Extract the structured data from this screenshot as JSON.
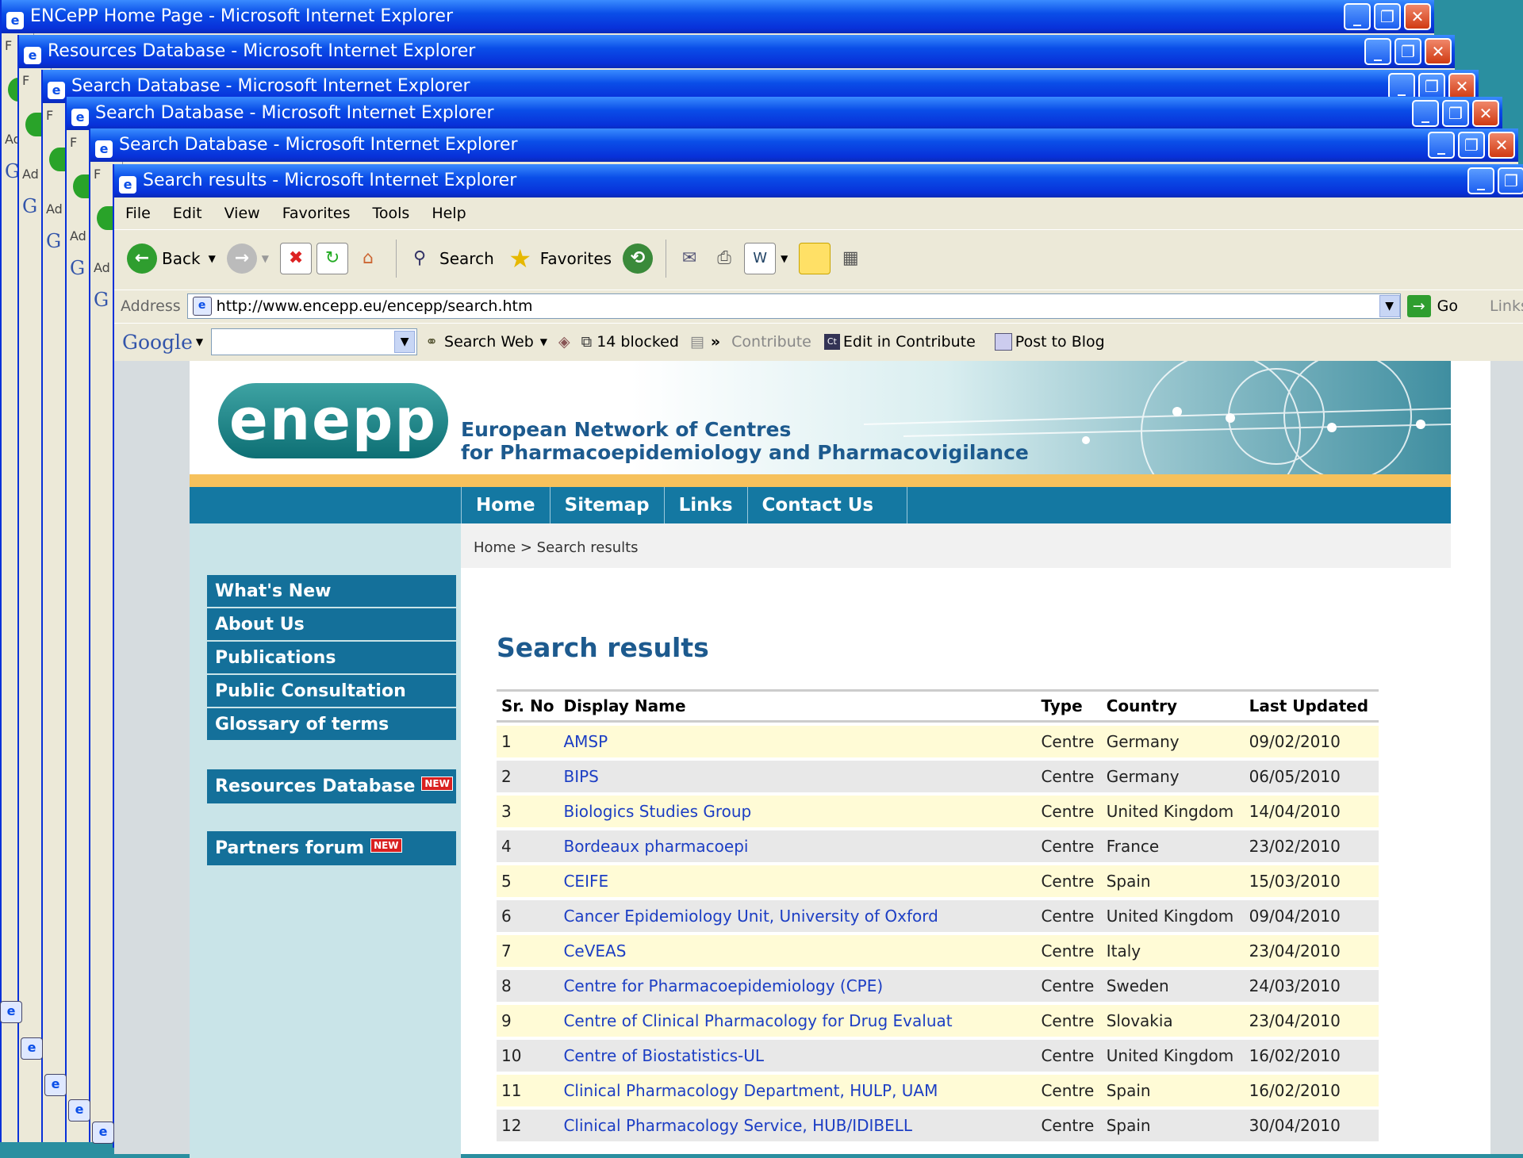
{
  "windows": [
    {
      "title": "ENCePP Home Page - Microsoft Internet Explorer"
    },
    {
      "title": "Resources Database - Microsoft Internet Explorer"
    },
    {
      "title": "Search Database - Microsoft Internet Explorer"
    },
    {
      "title": "Search Database - Microsoft Internet Explorer"
    },
    {
      "title": "Search Database - Microsoft Internet Explorer"
    },
    {
      "title": "Search results - Microsoft Internet Explorer"
    }
  ],
  "strip": {
    "f": "F",
    "ad": "Ad",
    "g": "G"
  },
  "menu": {
    "file": "File",
    "edit": "Edit",
    "view": "View",
    "favorites": "Favorites",
    "tools": "Tools",
    "help": "Help"
  },
  "toolbar": {
    "back": "Back",
    "search": "Search",
    "favorites": "Favorites"
  },
  "address": {
    "label": "Address",
    "url": "http://www.encepp.eu/encepp/search.htm",
    "go": "Go",
    "links": "Links"
  },
  "google": {
    "logo": "Google",
    "search_web": "Search Web",
    "blocked": "14 blocked",
    "more": "»",
    "contribute": "Contribute",
    "edit_contribute": "Edit in Contribute",
    "post_blog": "Post to Blog"
  },
  "site": {
    "logo": "enepp",
    "tagline1": "European Network of Centres",
    "tagline2": "for Pharmacoepidemiology and Pharmacovigilance",
    "nav": [
      "Home",
      "Sitemap",
      "Links",
      "Contact Us"
    ],
    "breadcrumb": "Home > Search results",
    "sidebar": [
      "What's New",
      "About Us",
      "Publications",
      "Public Consultation",
      "Glossary of terms"
    ],
    "resources_db": "Resources Database",
    "partners_forum": "Partners forum",
    "new_badge": "NEW",
    "heading": "Search results"
  },
  "table": {
    "headers": [
      "Sr. No",
      "Display Name",
      "Type",
      "Country",
      "Last Updated"
    ],
    "rows": [
      [
        "1",
        "AMSP",
        "Centre",
        "Germany",
        "09/02/2010"
      ],
      [
        "2",
        "BIPS",
        "Centre",
        "Germany",
        "06/05/2010"
      ],
      [
        "3",
        "Biologics Studies Group",
        "Centre",
        "United Kingdom",
        "14/04/2010"
      ],
      [
        "4",
        "Bordeaux pharmacoepi",
        "Centre",
        "France",
        "23/02/2010"
      ],
      [
        "5",
        "CEIFE",
        "Centre",
        "Spain",
        "15/03/2010"
      ],
      [
        "6",
        "Cancer Epidemiology Unit, University of Oxford",
        "Centre",
        "United Kingdom",
        "09/04/2010"
      ],
      [
        "7",
        "CeVEAS",
        "Centre",
        "Italy",
        "23/04/2010"
      ],
      [
        "8",
        "Centre for Pharmacoepidemiology (CPE)",
        "Centre",
        "Sweden",
        "24/03/2010"
      ],
      [
        "9",
        "Centre of Clinical Pharmacology for Drug Evaluat",
        "Centre",
        "Slovakia",
        "23/04/2010"
      ],
      [
        "10",
        "Centre of Biostatistics-UL",
        "Centre",
        "United Kingdom",
        "16/02/2010"
      ],
      [
        "11",
        "Clinical Pharmacology Department, HULP, UAM",
        "Centre",
        "Spain",
        "16/02/2010"
      ],
      [
        "12",
        "Clinical Pharmacology Service, HUB/IDIBELL",
        "Centre",
        "Spain",
        "30/04/2010"
      ]
    ]
  }
}
